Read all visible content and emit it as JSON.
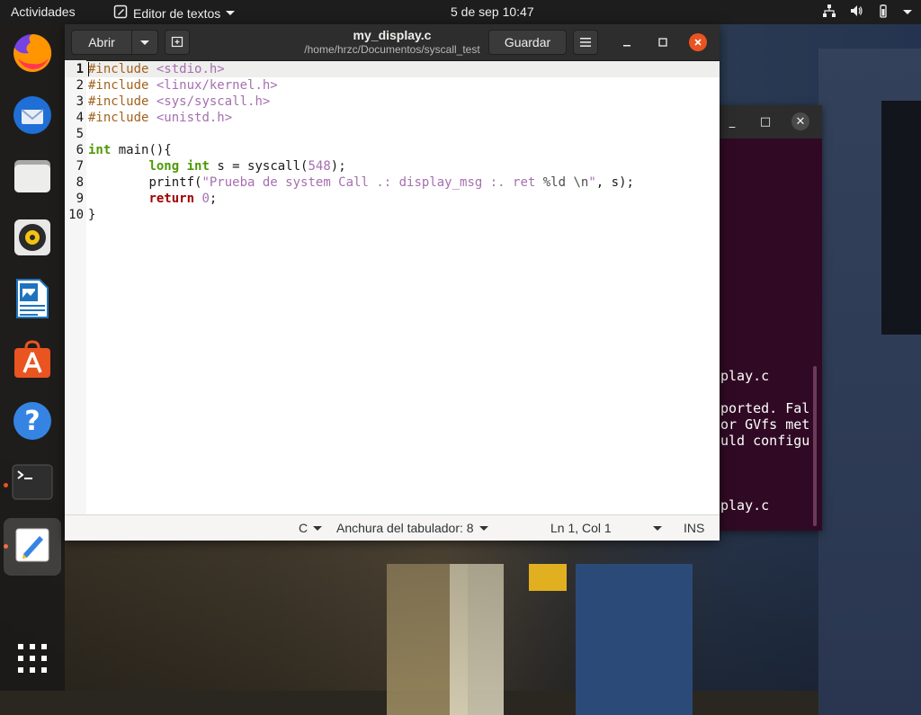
{
  "topbar": {
    "activities": "Actividades",
    "app_name": "Editor de textos",
    "clock": "5 de sep  10:47"
  },
  "editor": {
    "open_label": "Abrir",
    "title": "my_display.c",
    "path": "/home/hrzc/Documentos/syscall_test",
    "save_label": "Guardar",
    "lines": [
      {
        "n": "1"
      },
      {
        "n": "2"
      },
      {
        "n": "3"
      },
      {
        "n": "4"
      },
      {
        "n": "5"
      },
      {
        "n": "6"
      },
      {
        "n": "7"
      },
      {
        "n": "8"
      },
      {
        "n": "9"
      },
      {
        "n": "10"
      }
    ],
    "code": {
      "l1_pp": "#include",
      "l1_hdr": "<stdio.h>",
      "l2_pp": "#include",
      "l2_hdr": "<linux/kernel.h>",
      "l3_pp": "#include",
      "l3_hdr": "<sys/syscall.h>",
      "l4_pp": "#include",
      "l4_hdr": "<unistd.h>",
      "l6_kw": "int",
      "l6_rest": " main(){",
      "l7_indent": "        ",
      "l7_kw1": "long",
      "l7_kw2": "int",
      "l7_mid": " s = syscall(",
      "l7_num": "548",
      "l7_end": ");",
      "l8_indent": "        ",
      "l8_fn": "printf(",
      "l8_str1": "\"Prueba de system Call .: display_msg :. ret ",
      "l8_fmt": "%ld",
      "l8_str2": " ",
      "l8_esc": "\\n",
      "l8_str3": "\"",
      "l8_end": ", s);",
      "l9_indent": "        ",
      "l9_kw": "return",
      "l9_num": "0",
      "l9_end": ";",
      "l10": "}"
    },
    "status": {
      "language": "C",
      "tab_width": "Anchura del tabulador: 8",
      "position": "Ln 1, Col 1",
      "mode": "INS"
    }
  },
  "terminal": {
    "lines": [
      "play.c",
      "ported. Fal",
      "or GVfs met",
      "uld configu",
      "play.c"
    ]
  },
  "dock": {
    "items": [
      "firefox-icon",
      "thunderbird-icon",
      "files-icon",
      "rhythmbox-icon",
      "libreoffice-writer-icon",
      "software-icon",
      "help-icon",
      "terminal-icon",
      "text-editor-icon",
      "show-apps-icon"
    ]
  },
  "colors": {
    "accent": "#e95420",
    "topbar": "#1d1d1d",
    "header": "#2d2d2d",
    "terminal_bg": "#300a24"
  }
}
